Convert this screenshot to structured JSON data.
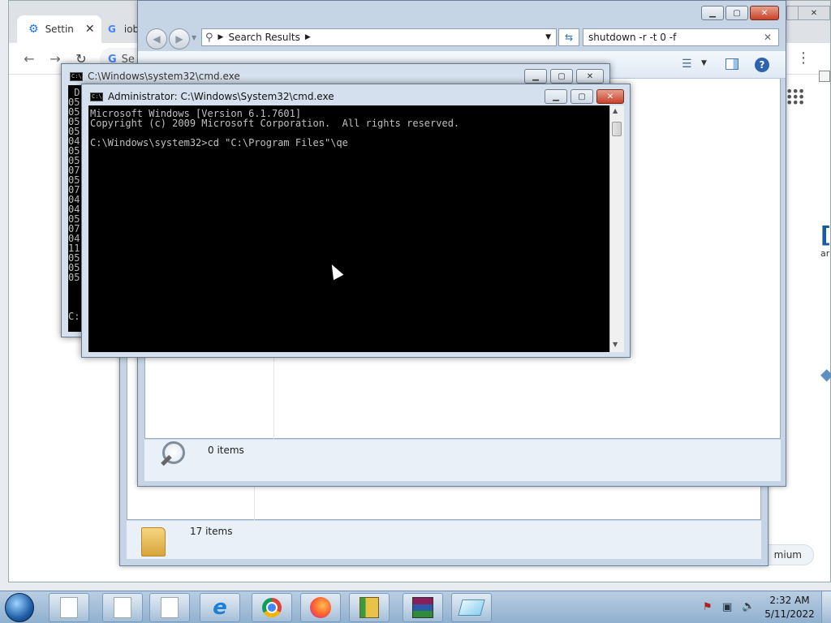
{
  "chrome": {
    "tabs": [
      {
        "label": "Settin",
        "icon": "gear-icon"
      },
      {
        "label": "iob",
        "icon": "google-icon"
      }
    ],
    "omnibox_text": "Se",
    "right_icons": {
      "menu": "⋮",
      "apps": "apps-grid-icon"
    },
    "premium_label": "mium"
  },
  "explorer_back": {
    "status_count": "17 items"
  },
  "explorer_front": {
    "address_path": "Search Results",
    "search_value": "shutdown -r -t 0 -f",
    "status_count": "0 items"
  },
  "cmd_back": {
    "title": "C:\\Windows\\system32\\cmd.exe",
    "lines": [
      " D",
      "05",
      "05",
      "05",
      "05",
      "04",
      "05",
      "05",
      "07",
      "05",
      "07",
      "04",
      "04",
      "05",
      "07",
      "04",
      "11",
      "05",
      "05",
      "05",
      "",
      "",
      "",
      "C:"
    ]
  },
  "cmd_front": {
    "title": "Administrator: C:\\Windows\\System32\\cmd.exe",
    "lines": [
      "Microsoft Windows [Version 6.1.7601]",
      "Copyright (c) 2009 Microsoft Corporation.  All rights reserved.",
      "",
      "C:\\Windows\\system32>cd \"C:\\Program Files\"\\qe"
    ]
  },
  "taskbar": {
    "time": "2:32 AM",
    "date": "5/11/2022"
  },
  "colors": {
    "console_bg": "#000000",
    "console_fg": "#c0c0c0",
    "close_red": "#c7422a",
    "taskbar": "#9fbbd8"
  }
}
